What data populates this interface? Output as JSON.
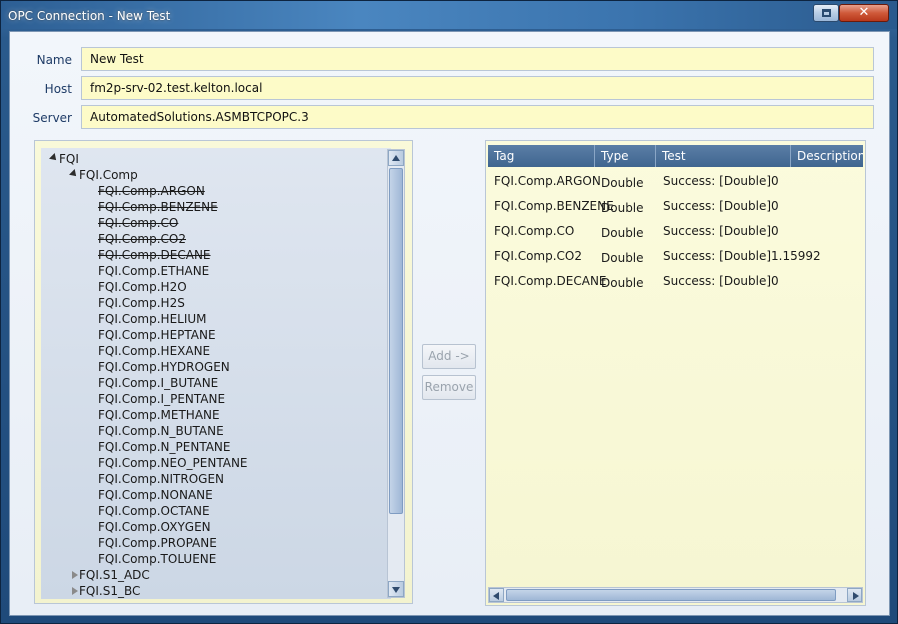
{
  "window": {
    "title": "OPC Connection - New Test",
    "close_glyph": "✕"
  },
  "form": {
    "name_label": "Name",
    "name_value": "New Test",
    "host_label": "Host",
    "host_value": "fm2p-srv-02.test.kelton.local",
    "server_label": "Server",
    "server_value": "AutomatedSolutions.ASMBTCPOPC.3"
  },
  "tree": {
    "root": "FQI",
    "comp": "FQI.Comp",
    "items": [
      {
        "label": "FQI.Comp.ARGON",
        "added": true
      },
      {
        "label": "FQI.Comp.BENZENE",
        "added": true
      },
      {
        "label": "FQI.Comp.CO",
        "added": true
      },
      {
        "label": "FQI.Comp.CO2",
        "added": true
      },
      {
        "label": "FQI.Comp.DECANE",
        "added": true
      },
      {
        "label": "FQI.Comp.ETHANE",
        "added": false
      },
      {
        "label": "FQI.Comp.H2O",
        "added": false
      },
      {
        "label": "FQI.Comp.H2S",
        "added": false
      },
      {
        "label": "FQI.Comp.HELIUM",
        "added": false
      },
      {
        "label": "FQI.Comp.HEPTANE",
        "added": false
      },
      {
        "label": "FQI.Comp.HEXANE",
        "added": false
      },
      {
        "label": "FQI.Comp.HYDROGEN",
        "added": false
      },
      {
        "label": "FQI.Comp.I_BUTANE",
        "added": false
      },
      {
        "label": "FQI.Comp.I_PENTANE",
        "added": false
      },
      {
        "label": "FQI.Comp.METHANE",
        "added": false
      },
      {
        "label": "FQI.Comp.N_BUTANE",
        "added": false
      },
      {
        "label": "FQI.Comp.N_PENTANE",
        "added": false
      },
      {
        "label": "FQI.Comp.NEO_PENTANE",
        "added": false
      },
      {
        "label": "FQI.Comp.NITROGEN",
        "added": false
      },
      {
        "label": "FQI.Comp.NONANE",
        "added": false
      },
      {
        "label": "FQI.Comp.OCTANE",
        "added": false
      },
      {
        "label": "FQI.Comp.OXYGEN",
        "added": false
      },
      {
        "label": "FQI.Comp.PROPANE",
        "added": false
      },
      {
        "label": "FQI.Comp.TOLUENE",
        "added": false
      }
    ],
    "siblings": [
      "FQI.S1_ADC",
      "FQI.S1_BC"
    ]
  },
  "buttons": {
    "add": "Add ->",
    "remove": "Remove"
  },
  "grid": {
    "columns": [
      "Tag",
      "Type",
      "Test",
      "Description"
    ],
    "rows": [
      [
        "FQI.Comp.ARGON",
        "Double",
        "Success: [Double]0",
        ""
      ],
      [
        "FQI.Comp.BENZENE",
        "Double",
        "Success: [Double]0",
        ""
      ],
      [
        "FQI.Comp.CO",
        "Double",
        "Success: [Double]0",
        ""
      ],
      [
        "FQI.Comp.CO2",
        "Double",
        "Success: [Double]1.15992",
        ""
      ],
      [
        "FQI.Comp.DECANE",
        "Double",
        "Success: [Double]0",
        ""
      ]
    ]
  }
}
